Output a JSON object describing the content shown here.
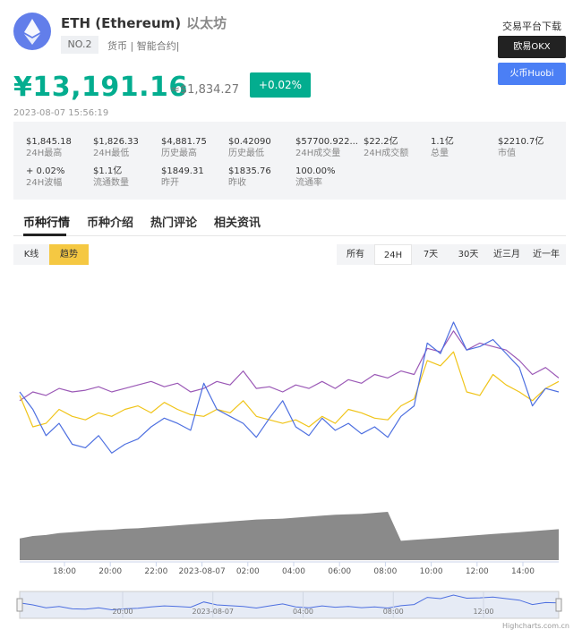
{
  "coin": {
    "symbol_name": "ETH (Ethereum)",
    "cn_name": "以太坊",
    "rank": "NO.2",
    "tags": "货币 | 智能合约|",
    "price": "¥13,191.16",
    "usd_price": "≈$1,834.27",
    "change": "+0.02%",
    "timestamp": "2023-08-07 15:56:19",
    "logo_icon": "ethereum-diamond",
    "brand_color": "#627eea",
    "price_color": "#03ad8f"
  },
  "download": {
    "title": "交易平台下载",
    "okx_label": "欧易OKX",
    "huobi_label": "火币Huobi"
  },
  "stats": [
    {
      "value": "$1,845.18",
      "label": "24H最高"
    },
    {
      "value": "$1,826.33",
      "label": "24H最低"
    },
    {
      "value": "$4,881.75",
      "label": "历史最高"
    },
    {
      "value": "$0.42090",
      "label": "历史最低"
    },
    {
      "value": "$57700.922...",
      "label": "24H成交量"
    },
    {
      "value": "$22.2亿",
      "label": "24H成交额"
    },
    {
      "value": "1.1亿",
      "label": "总量"
    },
    {
      "value": "$2210.7亿",
      "label": "市值"
    },
    {
      "value": "+ 0.02%",
      "label": "24H波幅"
    },
    {
      "value": "$1.1亿",
      "label": "流通数量"
    },
    {
      "value": "$1849.31",
      "label": "昨开"
    },
    {
      "value": "$1835.76",
      "label": "昨收"
    },
    {
      "value": "100.00%",
      "label": "流通率"
    }
  ],
  "tabs": [
    "币种行情",
    "币种介绍",
    "热门评论",
    "相关资讯"
  ],
  "chart_toggle": [
    "K线",
    "趋势"
  ],
  "time_ranges": [
    "所有",
    "24H",
    "7天",
    "30天",
    "近三月",
    "近一年"
  ],
  "chart_data": {
    "type": "line",
    "x_labels": [
      "18:00",
      "20:00",
      "22:00",
      "2023-08-07",
      "02:00",
      "04:00",
      "06:00",
      "08:00",
      "10:00",
      "12:00",
      "14:00"
    ],
    "navigator_labels": [
      "20:00",
      "2023-08-07",
      "04:00",
      "08:00",
      "12:00"
    ],
    "series": [
      {
        "color": "#9b59b6",
        "values": [
          0.55,
          0.6,
          0.58,
          0.62,
          0.6,
          0.61,
          0.63,
          0.6,
          0.62,
          0.64,
          0.66,
          0.63,
          0.65,
          0.6,
          0.62,
          0.66,
          0.64,
          0.72,
          0.62,
          0.63,
          0.6,
          0.64,
          0.62,
          0.66,
          0.62,
          0.67,
          0.65,
          0.7,
          0.68,
          0.72,
          0.7,
          0.85,
          0.83,
          0.95,
          0.84,
          0.88,
          0.86,
          0.84,
          0.78,
          0.7,
          0.74,
          0.68
        ]
      },
      {
        "color": "#f0c419",
        "values": [
          0.58,
          0.4,
          0.42,
          0.5,
          0.46,
          0.44,
          0.48,
          0.46,
          0.5,
          0.52,
          0.48,
          0.54,
          0.5,
          0.47,
          0.46,
          0.5,
          0.48,
          0.55,
          0.46,
          0.44,
          0.42,
          0.44,
          0.4,
          0.46,
          0.42,
          0.5,
          0.48,
          0.45,
          0.44,
          0.52,
          0.56,
          0.78,
          0.75,
          0.83,
          0.6,
          0.58,
          0.7,
          0.64,
          0.6,
          0.55,
          0.62,
          0.66
        ]
      },
      {
        "color": "#4d6fe0",
        "values": [
          0.6,
          0.5,
          0.35,
          0.42,
          0.3,
          0.28,
          0.35,
          0.25,
          0.3,
          0.33,
          0.4,
          0.45,
          0.42,
          0.38,
          0.65,
          0.5,
          0.46,
          0.42,
          0.34,
          0.45,
          0.55,
          0.4,
          0.35,
          0.45,
          0.38,
          0.42,
          0.36,
          0.4,
          0.34,
          0.46,
          0.52,
          0.88,
          0.82,
          1.0,
          0.84,
          0.86,
          0.9,
          0.82,
          0.74,
          0.52,
          0.62,
          0.6
        ]
      }
    ],
    "volume_values": [
      0.45,
      0.5,
      0.52,
      0.56,
      0.58,
      0.6,
      0.62,
      0.63,
      0.65,
      0.66,
      0.68,
      0.7,
      0.72,
      0.74,
      0.76,
      0.78,
      0.8,
      0.82,
      0.84,
      0.85,
      0.86,
      0.88,
      0.9,
      0.92,
      0.94,
      0.95,
      0.96,
      0.98,
      1.0,
      0.4,
      0.42,
      0.44,
      0.46,
      0.48,
      0.5,
      0.52,
      0.54,
      0.56,
      0.58,
      0.6,
      0.62,
      0.64
    ],
    "volume_color": "#8a8a8a",
    "credit": "Highcharts.com.cn"
  }
}
